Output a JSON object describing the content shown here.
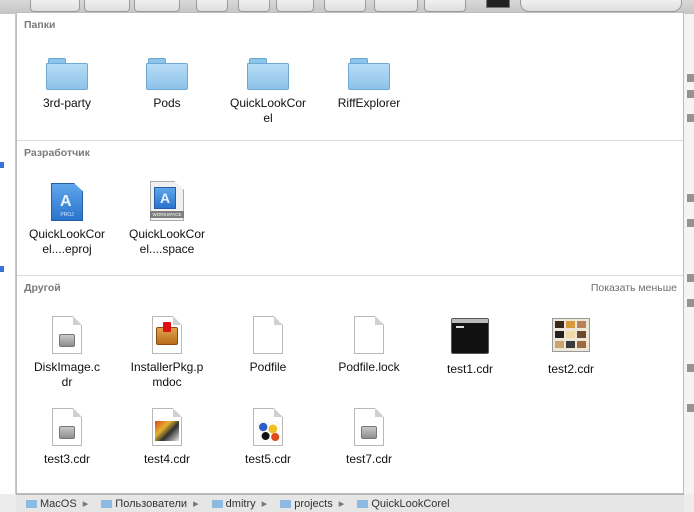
{
  "sections": {
    "folders": {
      "header": "Папки",
      "items": [
        {
          "label": "3rd-party",
          "icon": "folder-icon"
        },
        {
          "label": "Pods",
          "icon": "folder-icon"
        },
        {
          "label": "QuickLookCorel",
          "icon": "folder-icon"
        },
        {
          "label": "RiffExplorer",
          "icon": "folder-icon"
        }
      ]
    },
    "developer": {
      "header": "Разработчик",
      "items": [
        {
          "label": "QuickLookCorel....eproj",
          "icon": "xcode-project-icon",
          "badge": "PROJ"
        },
        {
          "label": "QuickLookCorel....space",
          "icon": "xcode-workspace-icon",
          "badge": "WORKSPACE"
        }
      ]
    },
    "other": {
      "header": "Другой",
      "show_less": "Показать меньше",
      "items": [
        {
          "label": "DiskImage.cdr",
          "icon": "disk-image-icon"
        },
        {
          "label": "InstallerPkg.pmdoc",
          "icon": "installer-package-icon"
        },
        {
          "label": "Podfile",
          "icon": "blank-document-icon"
        },
        {
          "label": "Podfile.lock",
          "icon": "blank-document-icon"
        },
        {
          "label": "test1.cdr",
          "icon": "terminal-thumbnail-icon"
        },
        {
          "label": "test2.cdr",
          "icon": "palette-thumbnail-icon"
        },
        {
          "label": "test3.cdr",
          "icon": "disk-image-icon"
        },
        {
          "label": "test4.cdr",
          "icon": "fish-thumbnail-icon"
        },
        {
          "label": "test5.cdr",
          "icon": "fish-collage-thumbnail-icon"
        },
        {
          "label": "test7.cdr",
          "icon": "disk-image-icon"
        }
      ]
    }
  },
  "pathbar": {
    "items": [
      "MacOS",
      "Пользователи",
      "dmitry",
      "projects",
      "QuickLookCorel"
    ]
  },
  "colors": {
    "folder": "#9cccef",
    "xcode_blue": "#2a74cd",
    "header_text": "#7a7a7a"
  }
}
